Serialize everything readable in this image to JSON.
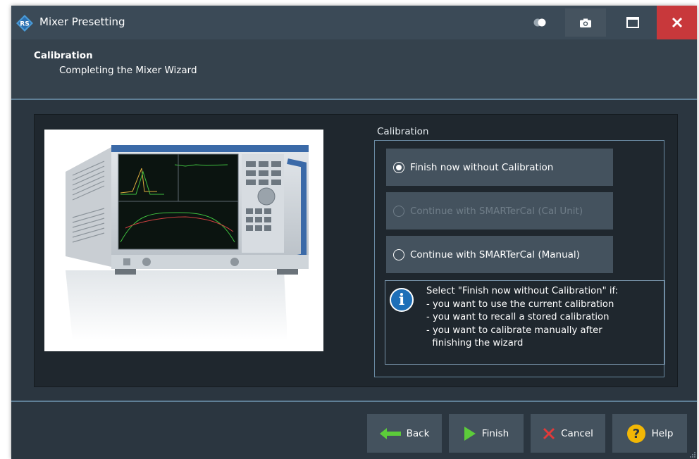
{
  "window": {
    "title": "Mixer Presetting"
  },
  "header": {
    "title": "Calibration",
    "subtitle": "Completing the Mixer Wizard"
  },
  "calibration": {
    "group_title": "Calibration",
    "options": [
      {
        "label": "Finish now without Calibration",
        "selected": true,
        "enabled": true
      },
      {
        "label": "Continue with SMARTerCal (Cal Unit)",
        "selected": false,
        "enabled": false
      },
      {
        "label": "Continue with SMARTerCal (Manual)",
        "selected": false,
        "enabled": true
      }
    ],
    "info": {
      "lines": [
        "Select \"Finish now without Calibration\" if:",
        "- you want to use the current calibration",
        "- you want to recall a stored calibration",
        "- you want to calibrate manually after",
        "  finishing the wizard"
      ]
    }
  },
  "footer": {
    "back_label": "Back",
    "finish_label": "Finish",
    "cancel_label": "Cancel",
    "help_label": "Help"
  },
  "icons": {
    "app_logo": "rs-logo-icon",
    "toggle": "toggle-icon",
    "camera": "camera-icon",
    "maximize": "maximize-icon",
    "close": "close-icon",
    "info": "info-icon",
    "back": "arrow-left-icon",
    "finish": "play-icon",
    "cancel": "x-icon",
    "help": "question-icon"
  },
  "colors": {
    "accent_green": "#5ccc3a",
    "cancel_red": "#e03a3a",
    "help_yellow": "#f2b705",
    "close_red": "#c8383b",
    "info_blue": "#1d6fb8"
  }
}
